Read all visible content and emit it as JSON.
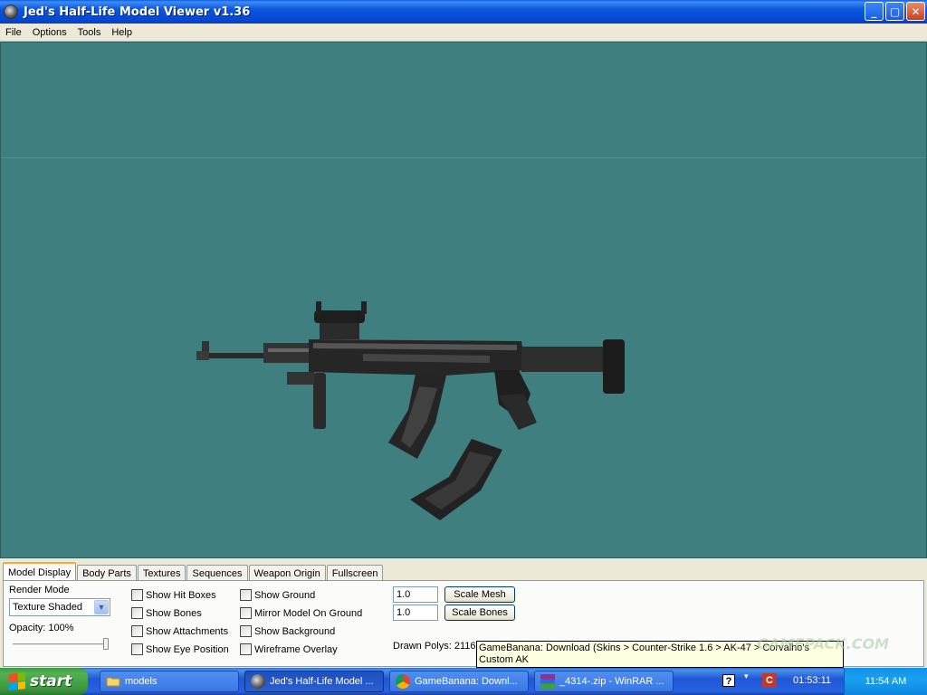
{
  "window": {
    "title": "Jed's Half-Life Model Viewer v1.36",
    "minimize": "_",
    "maximize": "▢",
    "close": "✕"
  },
  "menu": [
    "File",
    "Options",
    "Tools",
    "Help"
  ],
  "tabs": [
    "Model Display",
    "Body Parts",
    "Textures",
    "Sequences",
    "Weapon Origin",
    "Fullscreen"
  ],
  "model_display": {
    "render_mode_label": "Render Mode",
    "render_mode_value": "Texture Shaded",
    "opacity_label": "Opacity: 100%",
    "opacity_value": 1.0,
    "checkboxes_col1": [
      "Show Hit Boxes",
      "Show Bones",
      "Show Attachments",
      "Show Eye Position"
    ],
    "checkboxes_col2": [
      "Show Ground",
      "Mirror Model On Ground",
      "Show Background",
      "Wireframe Overlay"
    ],
    "scale_mesh_value": "1.0",
    "scale_mesh_button": "Scale Mesh",
    "scale_bones_value": "1.0",
    "scale_bones_button": "Scale Bones",
    "drawn_polys": "Drawn Polys: 2116"
  },
  "tooltip": "GameBanana: Download (Skins > Counter-Strike 1.6 > AK-47 > Corvalho's Custom AK",
  "watermark": "GAMEPACK.COM",
  "taskbar": {
    "start": "start",
    "tasks": [
      "models",
      "Jed's Half-Life Model ...",
      "GameBanana: Downl...",
      "_4314-.zip - WinRAR ..."
    ],
    "timer": "01:53:11",
    "clock": "11:54 AM"
  },
  "colors": {
    "viewport_bg": "#3f7f7f",
    "titlebar": "#0b55e0",
    "taskbar": "#2457d7",
    "start_button": "#3d953d"
  }
}
